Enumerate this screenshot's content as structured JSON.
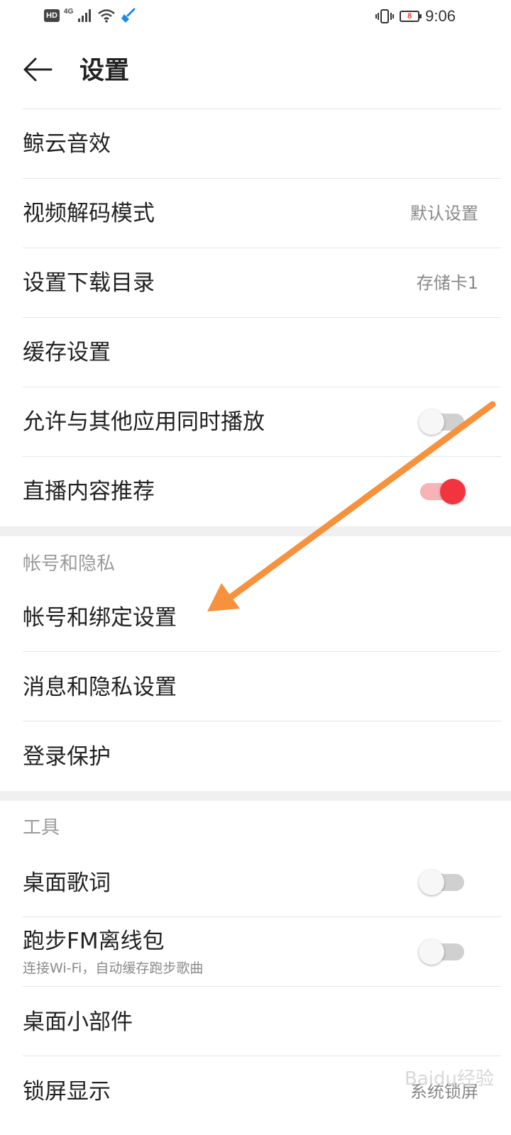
{
  "status_bar": {
    "hd": "HD",
    "network": "4G",
    "battery_level": "8",
    "time": "9:06"
  },
  "header": {
    "title": "设置"
  },
  "settings": [
    {
      "label": "鲸云音效"
    },
    {
      "label": "视频解码模式",
      "value": "默认设置"
    },
    {
      "label": "设置下载目录",
      "value": "存储卡1"
    },
    {
      "label": "缓存设置"
    },
    {
      "label": "允许与其他应用同时播放",
      "toggle": false
    },
    {
      "label": "直播内容推荐",
      "toggle": true
    }
  ],
  "account_section": {
    "title": "帐号和隐私",
    "items": [
      {
        "label": "帐号和绑定设置"
      },
      {
        "label": "消息和隐私设置"
      },
      {
        "label": "登录保护"
      }
    ]
  },
  "tools_section": {
    "title": "工具",
    "items": [
      {
        "label": "桌面歌词",
        "toggle": false
      },
      {
        "label": "跑步FM离线包",
        "subtitle": "连接Wi-Fi，自动缓存跑步歌曲",
        "toggle": false
      },
      {
        "label": "桌面小部件"
      },
      {
        "label": "锁屏显示",
        "value": "系统锁屏"
      }
    ]
  },
  "colors": {
    "accent": "#f2343e",
    "annotation_arrow": "#f6923d"
  },
  "watermark": "Baidu经验"
}
